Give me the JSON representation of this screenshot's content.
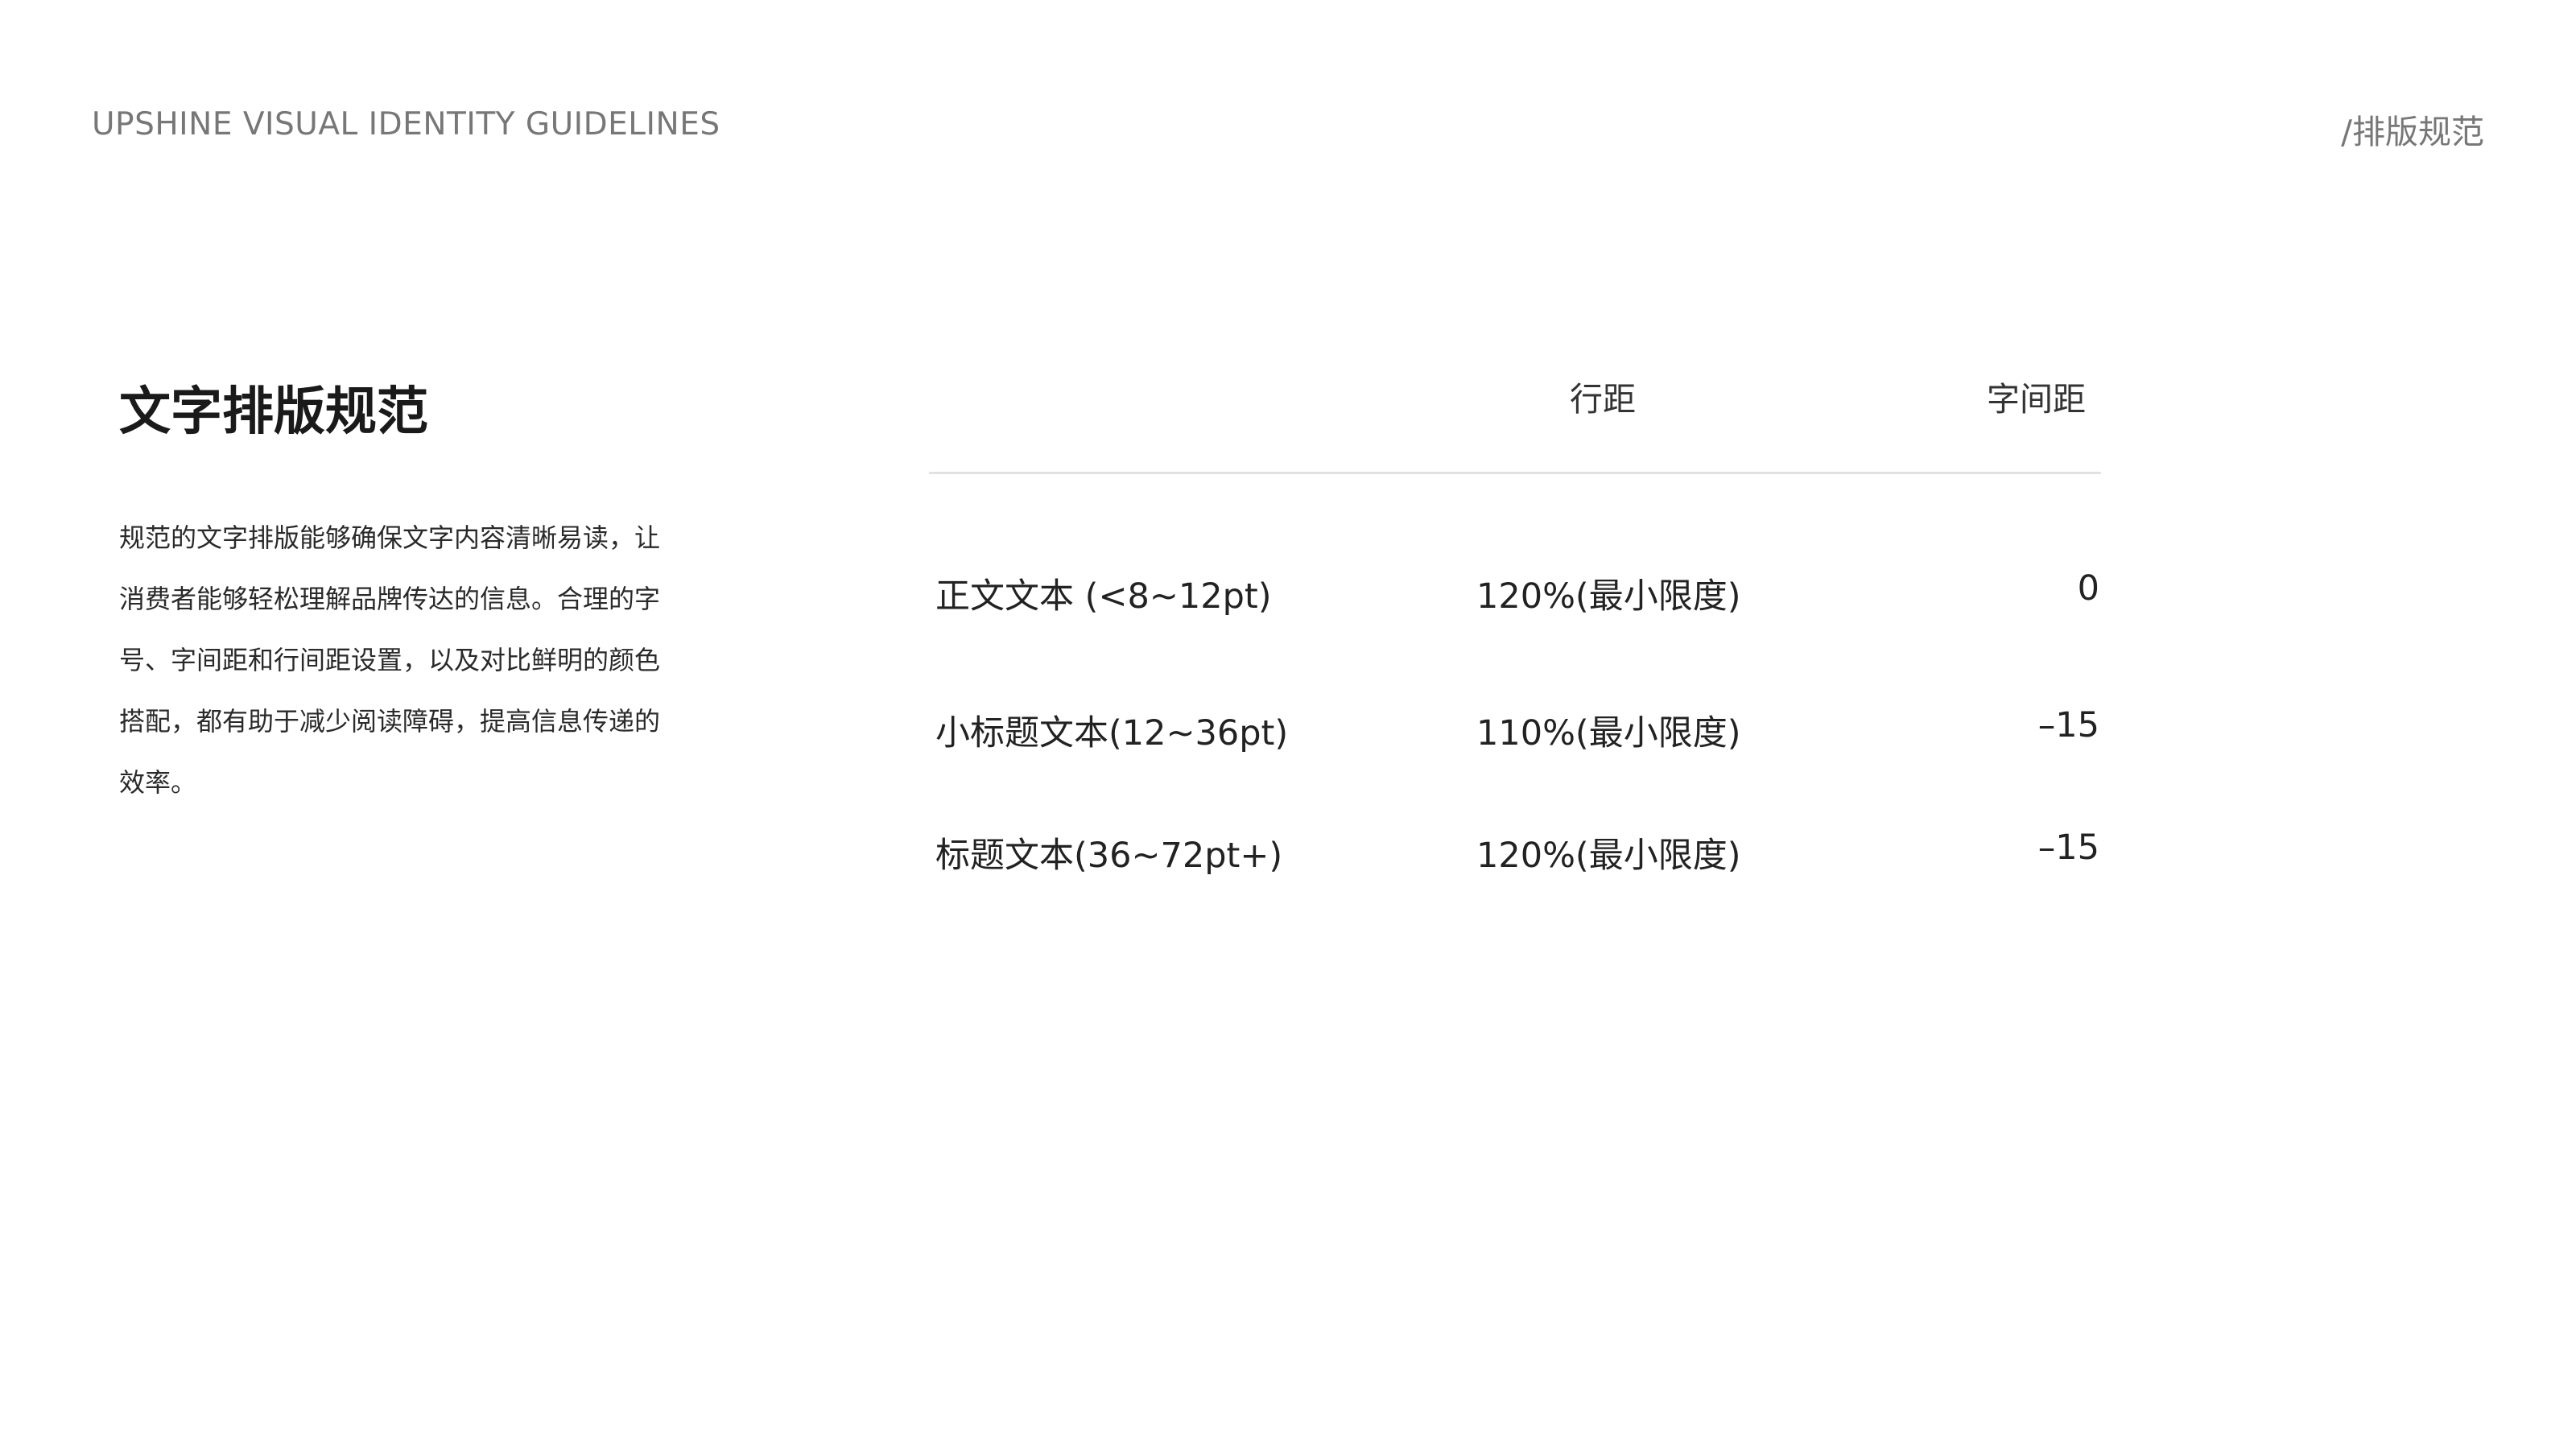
{
  "header": {
    "brand_title": "UPSHINE VISUAL IDENTITY GUIDELINES",
    "section": "/排版规范"
  },
  "main": {
    "title": "文字排版规范",
    "description": "规范的文字排版能够确保文字内容清晰易读，让消费者能够轻松理解品牌传达的信息。合理的字号、字间距和行间距设置，以及对比鲜明的颜色搭配，都有助于减少阅读障碍，提高信息传递的效率。"
  },
  "table": {
    "columns": [
      "行距",
      "字间距"
    ],
    "rows": [
      {
        "type": "正文文本 (<8~12pt)",
        "line_spacing": "120%(最小限度)",
        "tracking": "0"
      },
      {
        "type": "小标题文本(12~36pt)",
        "line_spacing": "110%(最小限度)",
        "tracking": "–15"
      },
      {
        "type": "标题文本(36~72pt+)",
        "line_spacing": "120%(最小限度)",
        "tracking": "–15"
      }
    ]
  }
}
